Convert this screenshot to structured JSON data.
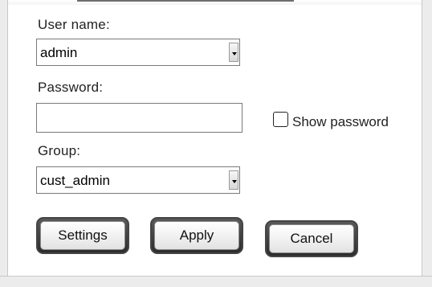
{
  "form": {
    "username_label": "User name:",
    "username_value": "admin",
    "password_label": "Password:",
    "password_value": "",
    "show_password_label": "Show password",
    "show_password_checked": false,
    "group_label": "Group:",
    "group_value": "cust_admin"
  },
  "buttons": {
    "settings": "Settings",
    "apply": "Apply",
    "cancel": "Cancel"
  }
}
